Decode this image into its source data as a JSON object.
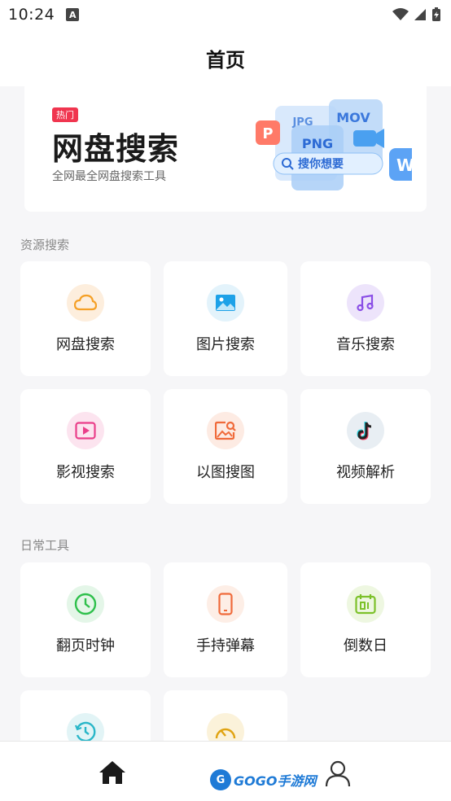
{
  "status_bar": {
    "time": "10:24",
    "notification_letter": "A"
  },
  "header": {
    "title": "首页"
  },
  "banner": {
    "badge": "热门",
    "title": "网盘搜索",
    "subtitle": "全网最全网盘搜索工具",
    "art": {
      "search_label": "搜你想要",
      "tags": [
        "JPG",
        "PNG",
        "MOV",
        "P",
        "W"
      ]
    }
  },
  "sections": {
    "resource": {
      "label": "资源搜索",
      "items": [
        {
          "label": "网盘搜索",
          "icon": "cloud-icon",
          "color": "#f5a026",
          "bg": "#fdeedd"
        },
        {
          "label": "图片搜索",
          "icon": "image-icon",
          "color": "#1da1e8",
          "bg": "#e3f3fb"
        },
        {
          "label": "音乐搜索",
          "icon": "music-note-icon",
          "color": "#8a4ee6",
          "bg": "#ede4fb"
        },
        {
          "label": "影视搜索",
          "icon": "video-play-icon",
          "color": "#ea3f8a",
          "bg": "#fce4ef"
        },
        {
          "label": "以图搜图",
          "icon": "image-search-icon",
          "color": "#f06a3a",
          "bg": "#fdebe3"
        },
        {
          "label": "视频解析",
          "icon": "tiktok-icon",
          "color": "#333333",
          "bg": "#e8eef3"
        }
      ]
    },
    "tools": {
      "label": "日常工具",
      "items": [
        {
          "label": "翻页时钟",
          "icon": "clock-icon",
          "color": "#2fc04c",
          "bg": "#e4f6e8"
        },
        {
          "label": "手持弹幕",
          "icon": "phone-icon",
          "color": "#f06a3a",
          "bg": "#fdeee6"
        },
        {
          "label": "倒数日",
          "icon": "calendar-icon",
          "color": "#7cc12a",
          "bg": "#eef7e1"
        },
        {
          "label": "",
          "icon": "history-clock-icon",
          "color": "#29b6c8",
          "bg": "#e2f4f6"
        },
        {
          "label": "",
          "icon": "speedometer-icon",
          "color": "#e0a312",
          "bg": "#fbf2da"
        }
      ]
    }
  },
  "tab_bar": {
    "home_icon": "home-icon",
    "profile_icon": "person-icon",
    "watermark": {
      "logo": "G",
      "text": "GOGO手游网"
    }
  }
}
